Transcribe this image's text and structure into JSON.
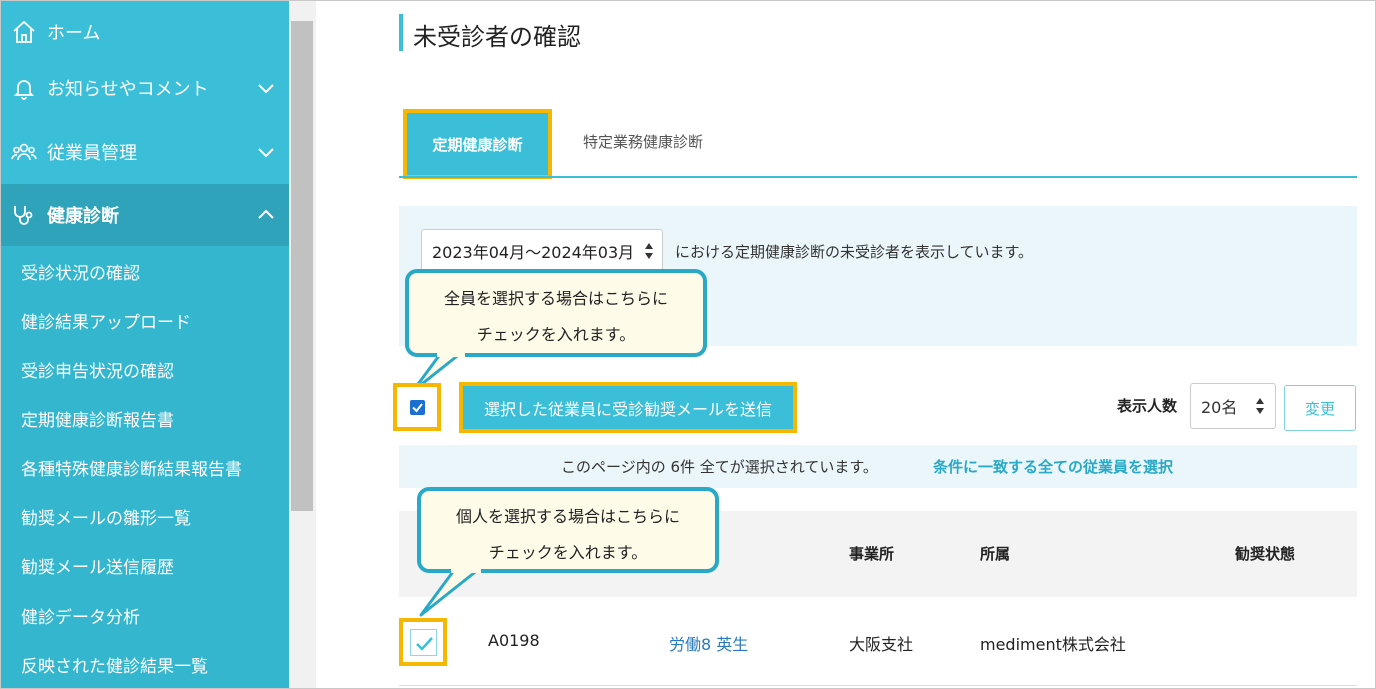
{
  "sidebar": {
    "home": "ホーム",
    "news": "お知らせやコメント",
    "employees": "従業員管理",
    "health": "健康診断",
    "sub_items": [
      "受診状況の確認",
      "健診結果アップロード",
      "受診申告状況の確認",
      "定期健康診断報告書",
      "各種特殊健康診断結果報告書",
      "勧奨メールの雛形一覧",
      "勧奨メール送信履歴",
      "健診データ分析",
      "反映された健診結果一覧"
    ]
  },
  "page": {
    "title": "未受診者の確認",
    "tabs": [
      "定期健康診断",
      "特定業務健康診断"
    ]
  },
  "filter": {
    "period": "2023年04月～2024年03月",
    "description": "における定期健康診断の未受診者を表示しています。"
  },
  "callouts": {
    "all_line1": "全員を選択する場合はこちらに",
    "all_line2": "チェックを入れます。",
    "one_line1": "個人を選択する場合はこちらに",
    "one_line2": "チェックを入れます。"
  },
  "actions": {
    "send_button": "選択した従業員に受診勧奨メールを送信",
    "count_label": "表示人数",
    "count_value": "20名",
    "change_button": "変更"
  },
  "selection": {
    "text": "このページ内の 6件 全てが選択されています。",
    "link": "条件に一致する全ての従業員を選択"
  },
  "table": {
    "headers": [
      "事業所",
      "所属",
      "勧奨状態"
    ],
    "rows": [
      {
        "id": "A0198",
        "name": "労働8 英生",
        "office": "大阪支社",
        "dept": "mediment株式会社",
        "checked": true
      }
    ]
  },
  "colors": {
    "accent": "#3bbfd9",
    "highlight": "#f5b700",
    "link": "#2a7bbd"
  }
}
